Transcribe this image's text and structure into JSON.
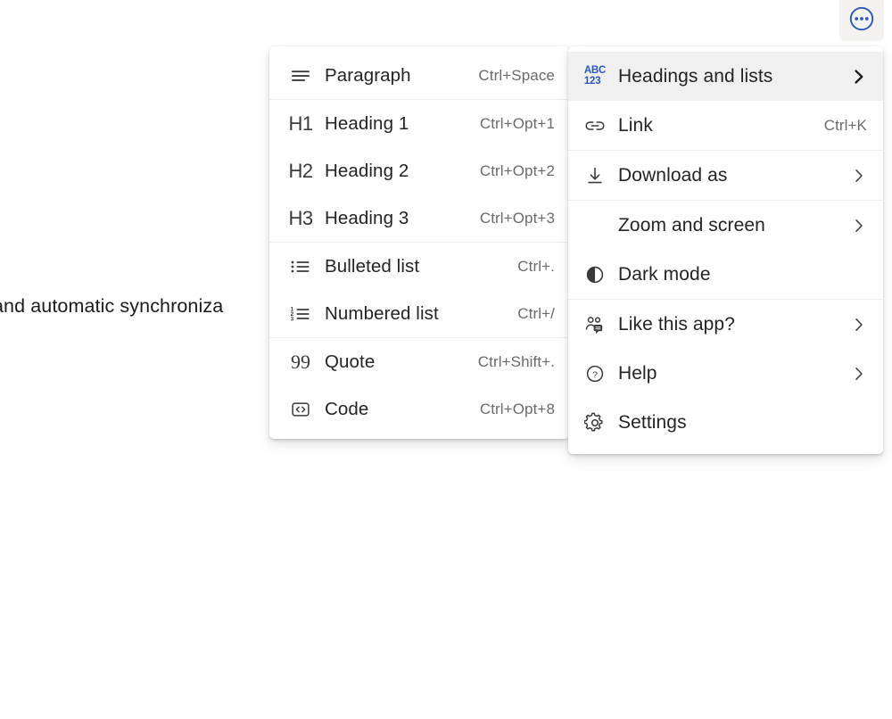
{
  "document": {
    "visible_text": "and automatic synchroniza"
  },
  "toolbar": {
    "more_button": {
      "label": "More options",
      "icon": "ellipsis-circle-icon",
      "accent_color": "#2a57b9",
      "background_color": "#f3f2f1"
    }
  },
  "menus": {
    "more_options": {
      "name": "More options menu",
      "active_item": "Headings and lists",
      "groups": [
        {
          "items": [
            {
              "label": "Headings and lists",
              "icon": "abc-123-icon",
              "accel": "",
              "submenu": true,
              "active": true
            },
            {
              "label": "Link",
              "icon": "link-icon",
              "accel": "Ctrl+K",
              "submenu": false,
              "active": false
            }
          ]
        },
        {
          "items": [
            {
              "label": "Download as",
              "icon": "download-icon",
              "accel": "",
              "submenu": true,
              "active": false
            }
          ]
        },
        {
          "items": [
            {
              "label": "Zoom and screen",
              "icon": "",
              "accel": "",
              "submenu": true,
              "active": false
            },
            {
              "label": "Dark mode",
              "icon": "dark-mode-icon",
              "accel": "",
              "submenu": false,
              "active": false
            }
          ]
        },
        {
          "items": [
            {
              "label": "Like this app?",
              "icon": "feedback-people-icon",
              "accel": "",
              "submenu": true,
              "active": false
            },
            {
              "label": "Help",
              "icon": "help-circle-icon",
              "accel": "",
              "submenu": true,
              "active": false
            },
            {
              "label": "Settings",
              "icon": "gear-icon",
              "accel": "",
              "submenu": false,
              "active": false
            }
          ]
        }
      ]
    },
    "headings_and_lists": {
      "name": "Headings and lists submenu",
      "groups": [
        {
          "items": [
            {
              "label": "Paragraph",
              "icon": "paragraph-icon",
              "accel": "Ctrl+Space"
            }
          ]
        },
        {
          "items": [
            {
              "label": "Heading 1",
              "icon": "h1-icon",
              "accel": "Ctrl+Opt+1"
            },
            {
              "label": "Heading 2",
              "icon": "h2-icon",
              "accel": "Ctrl+Opt+2"
            },
            {
              "label": "Heading 3",
              "icon": "h3-icon",
              "accel": "Ctrl+Opt+3"
            }
          ]
        },
        {
          "items": [
            {
              "label": "Bulleted list",
              "icon": "bulleted-list-icon",
              "accel": "Ctrl+."
            },
            {
              "label": "Numbered list",
              "icon": "numbered-list-icon",
              "accel": "Ctrl+/"
            }
          ]
        },
        {
          "items": [
            {
              "label": "Quote",
              "icon": "quote-icon",
              "accel": "Ctrl+Shift+."
            },
            {
              "label": "Code",
              "icon": "code-icon",
              "accel": "Ctrl+Opt+8"
            }
          ]
        }
      ]
    }
  },
  "icon_glyphs": {
    "h1": "H1",
    "h2": "H2",
    "h3": "H3",
    "quote": "99",
    "abc": "ABC",
    "123": "123"
  }
}
